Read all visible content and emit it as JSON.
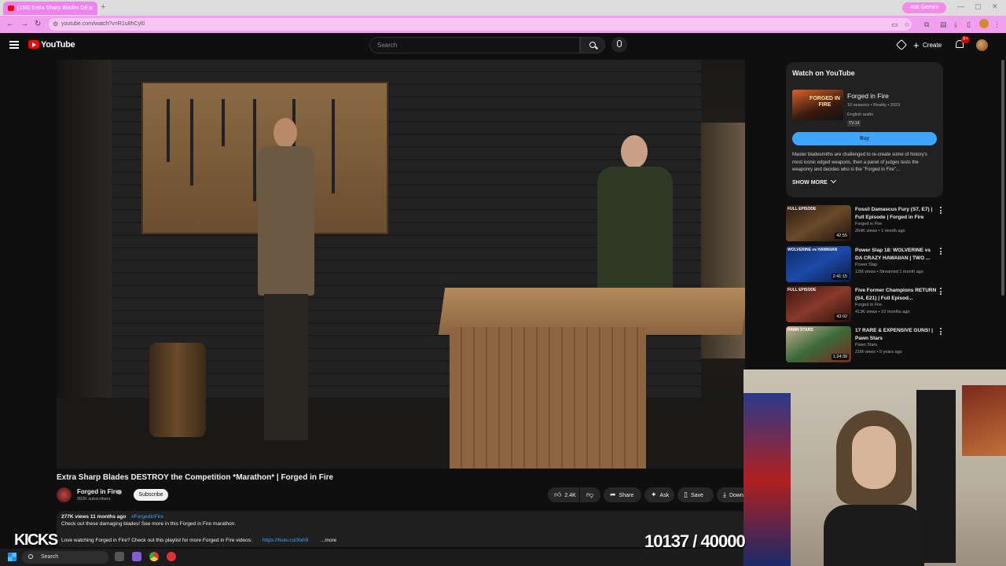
{
  "browser": {
    "tab_title": "(168) Extra Sharp Blades DE...",
    "new_tab": "+",
    "ask_gemini": "Ask Gemini",
    "url": "youtube.com/watch?v=R1u8hCyl0"
  },
  "header": {
    "logo_text": "YouTube",
    "search_placeholder": "Search",
    "create_label": "Create",
    "notification_count": "9+"
  },
  "video": {
    "title": "Extra Sharp Blades DESTROY the Competition *Marathon* | Forged in Fire",
    "channel_name": "Forged in Fire",
    "subscriber_count": "992K subscribers",
    "subscribe_label": "Subscribe",
    "like_count": "2.4K",
    "share_label": "Share",
    "ask_label": "Ask",
    "save_label": "Save",
    "download_label": "Down",
    "description": {
      "stats": "277K views  11 months ago",
      "hashtag": "#ForgedInFire",
      "line1": "Check out these damaging blades! See more in this Forged in Fire marathon.",
      "line2": "Love watching Forged in Fire? Check out this playlist for more Forged in Fire videos:",
      "link": "https://histv.co/3lxh9",
      "more_label": "...more"
    }
  },
  "watch_on_youtube": {
    "heading": "Watch on YouTube",
    "thumb_logo": "FORGED IN FIRE",
    "show_title": "Forged in Fire",
    "show_meta": "10 seasons • Reality • 2023",
    "audio": "English audio",
    "rating": "TV-14",
    "buy_label": "Buy",
    "description": "Master bladesmiths are challenged to re-create some of history's most iconic edged weapons, then a panel of judges tests the weaponry and decides who is the \"Forged in Fire\"...",
    "show_more_label": "SHOW MORE"
  },
  "recommendations": [
    {
      "tag": "FULL EPISODE",
      "duration": "42:55",
      "title": "Fossil Damascus Fury (S7, E7) | Full Episode | Forged in Fire",
      "channel": "Forged in Fire",
      "meta": "264K views • 1 month ago",
      "thumb_color": "#6b4a2a"
    },
    {
      "tag": "WOLVERINE vs HAWAIIAN",
      "duration": "2:41:15",
      "title": "Power Slap 18: WOLVERINE vs DA CRAZY HAWAIIAN | TWO ...",
      "channel": "Power Slap",
      "meta": "12M views • Streamed 1 month ago",
      "thumb_color": "#1d4aa8"
    },
    {
      "tag": "FULL EPISODE",
      "duration": "43:02",
      "title": "Five Former Champions RETURN (S4, E21) | Full Episod...",
      "channel": "Forged in Fire",
      "meta": "413K views • 10 months ago",
      "thumb_color": "#8a3a2a"
    },
    {
      "tag": "PAWN STARS",
      "duration": "1:24:39",
      "title": "17 RARE & EXPENSIVE GUNS! | Pawn Stars",
      "channel": "Pawn Stars",
      "meta": "21M views • 5 years ago",
      "thumb_color": "#3a6a3a"
    }
  ],
  "overlay": {
    "kicks_label": "KICKS",
    "counter": "10137 / 40000"
  },
  "taskbar": {
    "search_label": "Search"
  },
  "colors": {
    "youtube_red": "#ff0000",
    "link_blue": "#3ea6ff",
    "browser_accent": "#f0a0ee",
    "page_bg": "#0f0f0f"
  }
}
